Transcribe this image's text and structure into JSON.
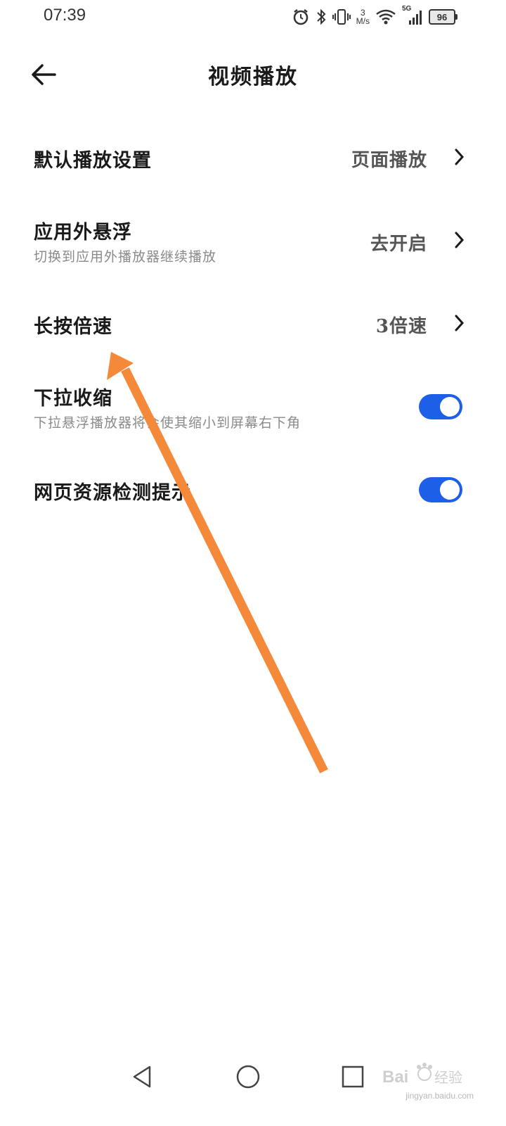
{
  "status_bar": {
    "time": "07:39",
    "net_speed_value": "3",
    "net_speed_unit": "M/s",
    "network_type": "5G",
    "battery_level": "96",
    "icons": [
      "alarm-icon",
      "bluetooth-icon",
      "vibrate-icon",
      "wifi-icon",
      "signal-icon",
      "battery-icon"
    ]
  },
  "header": {
    "title": "视频播放",
    "back_icon": "back-arrow-icon"
  },
  "settings": {
    "default_play": {
      "title": "默认播放设置",
      "value": "页面播放"
    },
    "floating": {
      "title": "应用外悬浮",
      "subtitle": "切换到应用外播放器继续播放",
      "value": "去开启"
    },
    "long_press_speed": {
      "title": "长按倍速",
      "value": "3倍速"
    },
    "pull_down_shrink": {
      "title": "下拉收缩",
      "subtitle": "下拉悬浮播放器将会使其缩小到屏幕右下角",
      "enabled": true
    },
    "resource_detect": {
      "title": "网页资源检测提示",
      "enabled": true
    }
  },
  "nav_bar": {
    "icons": [
      "nav-back-icon",
      "nav-home-icon",
      "nav-recents-icon"
    ]
  },
  "watermark": {
    "text": "jingyan.baidu.com"
  },
  "colors": {
    "toggle_on": "#1d5fe6",
    "annotation_arrow": "#f5893a"
  }
}
